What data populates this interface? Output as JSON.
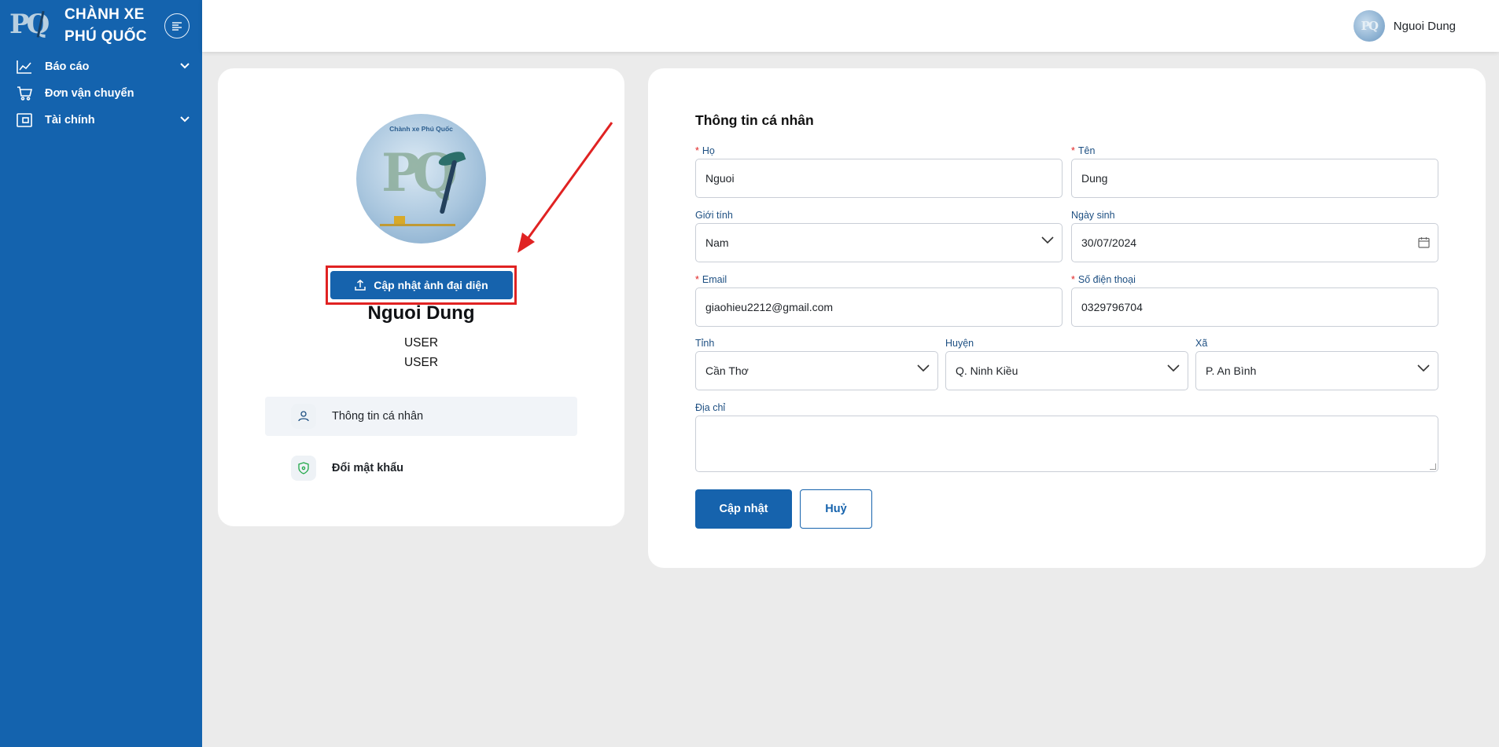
{
  "sidebar": {
    "brand_logo_text": "PQ",
    "brand_line1": "CHÀNH XE",
    "brand_line2": "PHÚ QUỐC",
    "items": [
      {
        "label": "Báo cáo",
        "icon": "line-chart-icon",
        "has_submenu": true
      },
      {
        "label": "Đơn vận chuyển",
        "icon": "cart-icon",
        "has_submenu": false
      },
      {
        "label": "Tài chính",
        "icon": "wallet-icon",
        "has_submenu": true
      }
    ]
  },
  "header": {
    "user_name": "Nguoi Dung",
    "avatar_text": "PQ"
  },
  "profile": {
    "avatar_caption": "Chành xe Phú Quốc",
    "avatar_text": "PQ",
    "upload_label": "Cập nhật ảnh đại diện",
    "name": "Nguoi Dung",
    "roles": [
      "USER",
      "USER"
    ],
    "menu": [
      {
        "label": "Thông tin cá nhân",
        "icon": "user-icon",
        "active": true
      },
      {
        "label": "Đổi mật khẩu",
        "icon": "shield-icon",
        "active": false
      }
    ]
  },
  "form": {
    "title": "Thông tin cá nhân",
    "last_name": {
      "label": "Họ",
      "required": true,
      "value": "Nguoi"
    },
    "first_name": {
      "label": "Tên",
      "required": true,
      "value": "Dung"
    },
    "gender": {
      "label": "Giới tính",
      "value": "Nam"
    },
    "dob": {
      "label": "Ngày sinh",
      "value": "30/07/2024"
    },
    "email": {
      "label": "Email",
      "required": true,
      "value": "giaohieu2212@gmail.com"
    },
    "phone": {
      "label": "Số điện thoại",
      "required": true,
      "value": "0329796704"
    },
    "province": {
      "label": "Tỉnh",
      "value": "Cần Thơ"
    },
    "district": {
      "label": "Huyện",
      "value": "Q. Ninh Kiều"
    },
    "ward": {
      "label": "Xã",
      "value": "P. An Bình"
    },
    "address": {
      "label": "Địa chỉ",
      "value": ""
    },
    "submit_label": "Cập nhật",
    "cancel_label": "Huỷ"
  },
  "colors": {
    "sidebar": "#1463ae",
    "primary": "#1663ad",
    "highlight": "#e02222",
    "required": "#e02424"
  }
}
